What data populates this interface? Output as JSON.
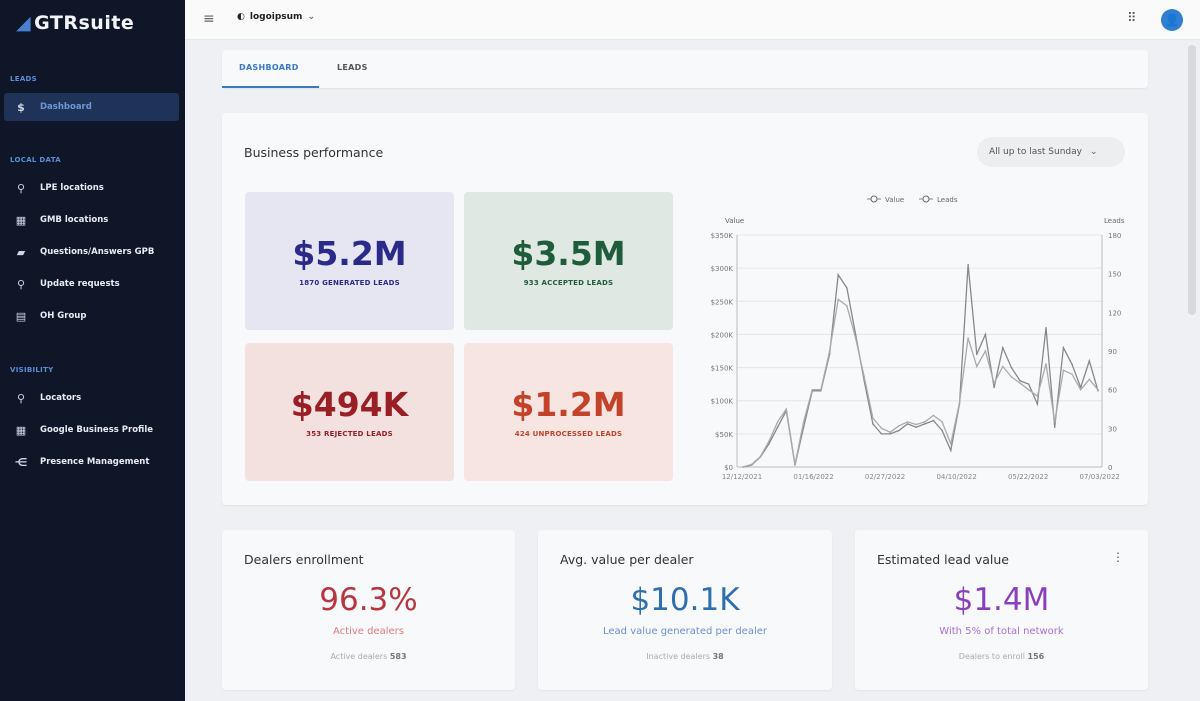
{
  "sidebar": {
    "brand": "GTRsuite",
    "sections": [
      {
        "title": "LEADS",
        "items": [
          {
            "label": "Dashboard",
            "icon": "dollar-icon",
            "active": true
          }
        ]
      },
      {
        "title": "LOCAL DATA",
        "items": [
          {
            "label": "LPE locations",
            "icon": "pin-icon"
          },
          {
            "label": "GMB locations",
            "icon": "store-icon"
          },
          {
            "label": "Questions/Answers GPB",
            "icon": "chat-icon"
          },
          {
            "label": "Update requests",
            "icon": "pin-icon"
          },
          {
            "label": "OH Group",
            "icon": "group-icon"
          }
        ]
      },
      {
        "title": "VISIBILITY",
        "items": [
          {
            "label": "Locators",
            "icon": "pin-icon"
          },
          {
            "label": "Google Business Profile",
            "icon": "store-icon"
          },
          {
            "label": "Presence Management",
            "icon": "tree-icon"
          }
        ]
      }
    ]
  },
  "topbar": {
    "org": "logoipsum"
  },
  "tabs": [
    {
      "label": "DASHBOARD",
      "active": true
    },
    {
      "label": "LEADS"
    }
  ],
  "performance": {
    "title": "Business performance",
    "period": "All up to last Sunday",
    "kpis": [
      {
        "value": "$5.2M",
        "label": "1870 GENERATED LEADS",
        "color": "#2a2a8a",
        "bg": "#e6e5f2"
      },
      {
        "value": "$3.5M",
        "label": "933 ACCEPTED LEADS",
        "color": "#1e5c3c",
        "bg": "#e0e8e4"
      },
      {
        "value": "$494K",
        "label": "353 REJECTED LEADS",
        "color": "#9a1f24",
        "bg": "#f3e1e0"
      },
      {
        "value": "$1.2M",
        "label": "424 UNPROCESSED LEADS",
        "color": "#c5422a",
        "bg": "#f7e5e2"
      }
    ]
  },
  "chart_data": {
    "type": "line",
    "legend": [
      "Value",
      "Leads"
    ],
    "legend_position": "top",
    "ylabel": "Value",
    "y2label": "Leads",
    "ylim": [
      0,
      350
    ],
    "y_ticks": [
      "$0",
      "$50K",
      "$100K",
      "$150K",
      "$200K",
      "$250K",
      "$300K",
      "$350K"
    ],
    "y2lim": [
      0,
      180
    ],
    "y2_ticks": [
      "0",
      "30",
      "60",
      "90",
      "120",
      "150",
      "180"
    ],
    "x_ticks": [
      "12/12/2021",
      "01/16/2022",
      "02/27/2022",
      "04/10/2022",
      "05/22/2022",
      "07/03/2022"
    ],
    "grid": true,
    "series": [
      {
        "name": "Value",
        "unit": "$K",
        "values": [
          0,
          3,
          15,
          35,
          60,
          85,
          3,
          60,
          115,
          115,
          170,
          290,
          270,
          200,
          130,
          65,
          50,
          50,
          55,
          65,
          60,
          65,
          70,
          55,
          25,
          95,
          305,
          170,
          200,
          120,
          180,
          150,
          130,
          125,
          95,
          210,
          60,
          180,
          155,
          120,
          160,
          115
        ]
      },
      {
        "name": "Leads",
        "values": [
          0,
          2,
          8,
          20,
          35,
          45,
          2,
          35,
          60,
          60,
          90,
          130,
          125,
          100,
          70,
          38,
          30,
          27,
          32,
          35,
          33,
          35,
          40,
          35,
          18,
          50,
          100,
          78,
          90,
          65,
          78,
          70,
          65,
          60,
          55,
          80,
          35,
          75,
          72,
          60,
          68,
          60
        ]
      }
    ]
  },
  "bottom": [
    {
      "title": "Dealers enrollment",
      "value": "96.3%",
      "sub": "Active dealers",
      "foot_label": "Active dealers",
      "foot_value": "583",
      "color": "#b8363f",
      "subcolor": "#e07a80"
    },
    {
      "title": "Avg. value per dealer",
      "value": "$10.1K",
      "sub": "Lead value generated per dealer",
      "foot_label": "Inactive dealers",
      "foot_value": "38",
      "color": "#2e6fb0",
      "subcolor": "#6a8fd0"
    },
    {
      "title": "Estimated lead value",
      "value": "$1.4M",
      "sub": "With 5% of total network",
      "foot_label": "Dealers to enroll",
      "foot_value": "156",
      "color": "#8a3fc0",
      "subcolor": "#a86fd8"
    }
  ]
}
